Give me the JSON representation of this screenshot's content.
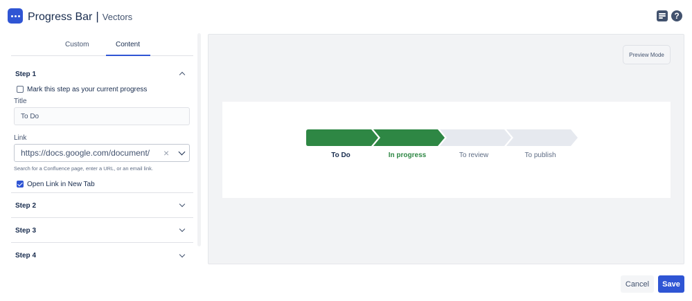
{
  "header": {
    "title": "Progress Bar",
    "separator": "|",
    "subtitle": "Vectors",
    "icons": [
      "doc-icon",
      "help-icon"
    ]
  },
  "tabs": [
    {
      "label": "Custom",
      "active": false
    },
    {
      "label": "Content",
      "active": true
    }
  ],
  "step1": {
    "heading": "Step 1",
    "expanded": true,
    "current_progress_label": "Mark this step as your current progress",
    "current_progress_checked": false,
    "title_label": "Title",
    "title_value": "To Do",
    "link_label": "Link",
    "link_value": "https://docs.google.com/document/",
    "link_clear": "×",
    "link_help": "Search for a Confluence page, enter a URL, or an email link.",
    "new_tab_label": "Open Link in New Tab",
    "new_tab_checked": true
  },
  "collapsed_steps": [
    "Step 2",
    "Step 3",
    "Step 4"
  ],
  "preview": {
    "mode_button": "Preview Mode",
    "steps": [
      {
        "label": "To Do",
        "state": "done"
      },
      {
        "label": "In progress",
        "state": "current"
      },
      {
        "label": "To review",
        "state": "todo"
      },
      {
        "label": "To publish",
        "state": "todo"
      }
    ],
    "colors": {
      "done": "#2e8744",
      "todo": "#e6e9ef",
      "accent": "#2f55d4"
    }
  },
  "footer": {
    "cancel_label": "Cancel",
    "save_label": "Save"
  }
}
